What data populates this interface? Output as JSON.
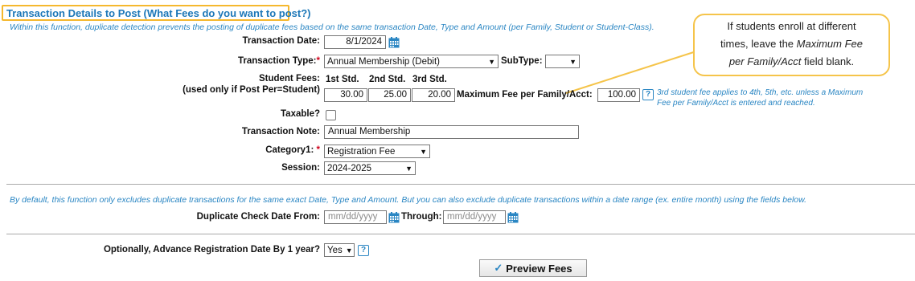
{
  "section_title": "Transaction Details to Post (What Fees do you want to post?)",
  "intro_text": "Within this function, duplicate detection prevents the posting of duplicate fees based on the same transaction Date, Type and Amount (per Family, Student or Student-Class).",
  "callout": {
    "line1": "If students enroll at different",
    "line2_pre": "times, leave the ",
    "line2_em": "Maximum Fee",
    "line3_em": "per Family/Acct",
    "line3_post": " field blank."
  },
  "form": {
    "transaction_date_label": "Transaction Date:",
    "transaction_date_value": "8/1/2024",
    "transaction_type_label": "Transaction Type:",
    "required_mark": "*",
    "transaction_type_value": "Annual Membership (Debit)",
    "subtype_label": "SubType:",
    "subtype_value": "",
    "student_fees_label": "Student Fees:",
    "student_fees_sublabel": "(used only if Post Per=Student)",
    "std_headers": [
      "1st Std.",
      "2nd Std.",
      "3rd Std."
    ],
    "std_fees": [
      "30.00",
      "25.00",
      "20.00"
    ],
    "max_fee_label": "Maximum Fee per Family/Acct:",
    "max_fee_value": "100.00",
    "max_fee_note_line1": "3rd student fee applies to 4th, 5th, etc. unless a Maximum",
    "max_fee_note_line2": "Fee per Family/Acct is entered and reached.",
    "taxable_label": "Taxable?",
    "transaction_note_label": "Transaction Note:",
    "transaction_note_value": "Annual Membership",
    "category1_label": "Category1:",
    "category1_value": "Registration Fee",
    "session_label": "Session:",
    "session_value": "2024-2025"
  },
  "duplicate": {
    "info_text": "By default, this function only excludes duplicate transactions for the same exact Date, Type and Amount. But you can also exclude duplicate transactions within a date range (ex. entire month) using the fields below.",
    "from_label": "Duplicate Check Date From:",
    "from_placeholder": "mm/dd/yyyy",
    "through_label": "Through:",
    "through_placeholder": "mm/dd/yyyy"
  },
  "advance": {
    "label": "Optionally, Advance Registration Date By 1 year?",
    "value": "Yes"
  },
  "preview_button": "Preview Fees",
  "icons": {
    "calendar": "calendar-icon",
    "help": "help-icon",
    "check": "checkmark-icon"
  },
  "colors": {
    "accent_blue": "#1c77b8",
    "highlight_yellow": "#f5b82e",
    "required_red": "#d0021b"
  }
}
